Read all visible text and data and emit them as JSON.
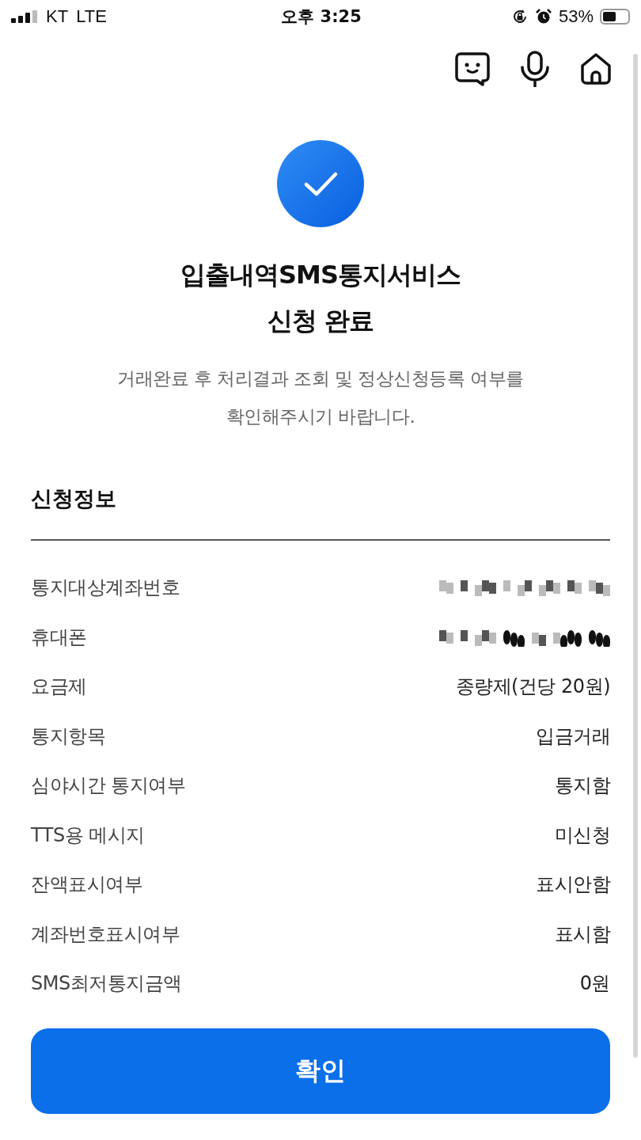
{
  "status_bar": {
    "carrier": "KT",
    "network": "LTE",
    "time": "오후 3:25",
    "battery_percent": "53%",
    "battery": {
      "level": 0.53
    }
  },
  "title_lines": [
    "입출내역SMS통지서비스",
    "신청 완료"
  ],
  "description": "거래완료 후 처리결과 조회 및 정상신청등록 여부를 확인해주시기 바랍니다.",
  "section_title": "신청정보",
  "rows": [
    {
      "label": "통지대상계좌번호",
      "kind": "redacted"
    },
    {
      "label": "휴대폰",
      "kind": "redacted"
    },
    {
      "label": "요금제",
      "kind": "text",
      "value": "종량제(건당 20원)"
    },
    {
      "label": "통지항목",
      "kind": "text",
      "value": "입금거래"
    },
    {
      "label": "심야시간 통지여부",
      "kind": "text",
      "value": "통지함"
    },
    {
      "label": "TTS용 메시지",
      "kind": "text",
      "value": "미신청"
    },
    {
      "label": "잔액표시여부",
      "kind": "text",
      "value": "표시안함"
    },
    {
      "label": "계좌번호표시여부",
      "kind": "text",
      "value": "표시함"
    },
    {
      "label": "SMS최저통지금액",
      "kind": "text",
      "value": "0원"
    }
  ],
  "confirm_button": "확인"
}
